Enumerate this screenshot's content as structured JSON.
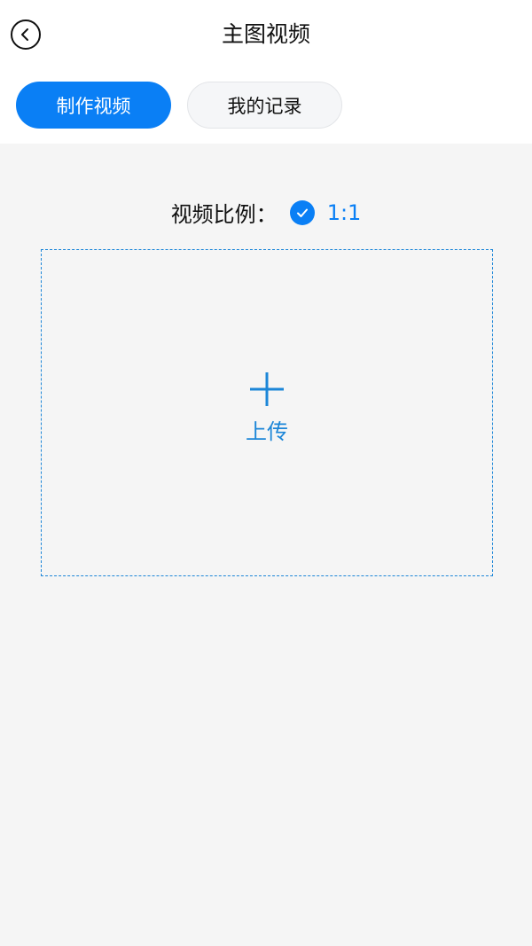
{
  "header": {
    "title": "主图视频",
    "back_icon": "back-arrow-icon"
  },
  "tabs": [
    {
      "label": "制作视频",
      "active": true
    },
    {
      "label": "我的记录",
      "active": false
    }
  ],
  "ratio": {
    "label": "视频比例：",
    "selected": "1:1",
    "check_icon": "check-circle-icon"
  },
  "upload": {
    "icon": "plus-icon",
    "label": "上传"
  },
  "colors": {
    "accent": "#0a7ff5",
    "upload_blue": "#1c86d8",
    "background": "#f5f5f5"
  }
}
